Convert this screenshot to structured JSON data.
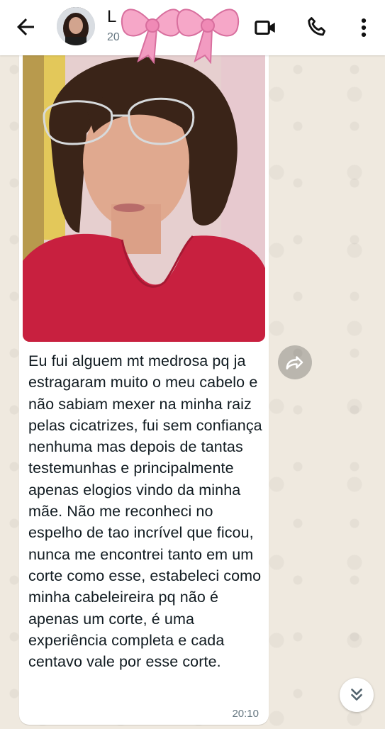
{
  "header": {
    "title": "L",
    "subtitle": "20",
    "icons": {
      "back": "arrow-left-icon",
      "video": "video-camera-icon",
      "call": "phone-icon",
      "menu": "more-vertical-icon",
      "decoration": "pink-bow"
    }
  },
  "message": {
    "text": "Eu fui alguem mt medrosa pq ja estragaram muito o meu cabelo e não sabiam mexer na minha raiz pelas cicatrizes, fui sem confiança nenhuma mas depois de tantas testemunhas e principalmente apenas elogios vindo da minha mãe. Não me reconheci no espelho de tao incrível que ficou, nunca me encontrei tanto em um corte como esse, estabeleci como minha cabeleireira pq não é apenas um corte, é uma experiência completa e cada centavo vale por esse corte.",
    "time": "20:10"
  },
  "colors": {
    "header_bg": "#ffffff",
    "wallpaper": "#efe9df",
    "bubble": "#ffffff",
    "time_text": "#667781",
    "shirt": "#c8203f",
    "bow": "#f29bc1"
  }
}
